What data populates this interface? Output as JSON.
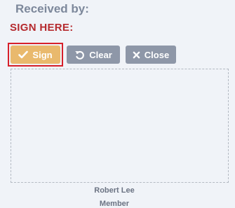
{
  "header": {
    "received_by": "Received by:",
    "sign_here": "SIGN HERE:"
  },
  "toolbar": {
    "sign_label": "Sign",
    "clear_label": "Clear",
    "close_label": "Close"
  },
  "signer": {
    "name": "Robert Lee",
    "role": "Member"
  },
  "colors": {
    "sign_button": "#e9b96d",
    "secondary_button": "#8e97a8",
    "sign_here_text": "#b52a2e",
    "focus_outline": "#d6202a"
  },
  "icons": {
    "sign": "check-icon",
    "clear": "undo-icon",
    "close": "close-icon"
  }
}
